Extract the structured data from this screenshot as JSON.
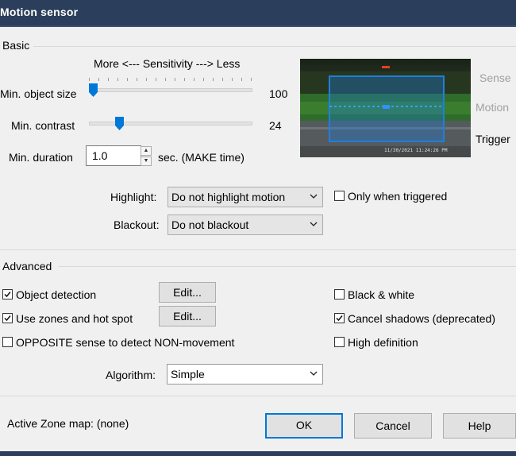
{
  "window": {
    "title": "Motion sensor"
  },
  "basic": {
    "group_label": "Basic",
    "sensitivity_caption": "More <--- Sensitivity ---> Less",
    "min_object_size": {
      "label": "Min. object size",
      "value": "100",
      "level": 0.0
    },
    "min_contrast": {
      "label": "Min. contrast",
      "value": "24",
      "level": 0.17
    },
    "min_duration": {
      "label": "Min. duration",
      "value": "1.0",
      "units": "sec.  (MAKE time)"
    },
    "preview": {
      "timestamp": "11/30/2021 11:24:26 PM"
    },
    "indicators": {
      "sense": "Sense",
      "motion": "Motion",
      "trigger": "Trigger"
    },
    "highlight": {
      "label": "Highlight:",
      "value": "Do not highlight motion"
    },
    "only_when_triggered": {
      "label": "Only when triggered",
      "checked": false
    },
    "blackout": {
      "label": "Blackout:",
      "value": "Do not blackout"
    }
  },
  "advanced": {
    "group_label": "Advanced",
    "object_detection": {
      "label": "Object detection",
      "checked": true,
      "edit_label": "Edit..."
    },
    "use_zones": {
      "label": "Use zones and hot spot",
      "checked": true,
      "edit_label": "Edit..."
    },
    "opposite_sense": {
      "label": "OPPOSITE sense to detect NON-movement",
      "checked": false
    },
    "black_white": {
      "label": "Black & white",
      "checked": false
    },
    "cancel_shadows": {
      "label": "Cancel shadows (deprecated)",
      "checked": true
    },
    "high_definition": {
      "label": "High definition",
      "checked": false
    },
    "algorithm": {
      "label": "Algorithm:",
      "value": "Simple"
    }
  },
  "footer": {
    "active_zone_map": "Active Zone map:  (none)",
    "ok_label": "OK",
    "cancel_label": "Cancel",
    "help_label": "Help"
  },
  "colors": {
    "title_bar": "#2b3e5b",
    "accent": "#0078d7",
    "detection_box": "#1e7fe0"
  },
  "icons": {
    "checkbox_check": "check-icon",
    "combo_arrow": "chevron-down-icon",
    "spin_up": "caret-up-icon",
    "spin_down": "caret-down-icon"
  }
}
